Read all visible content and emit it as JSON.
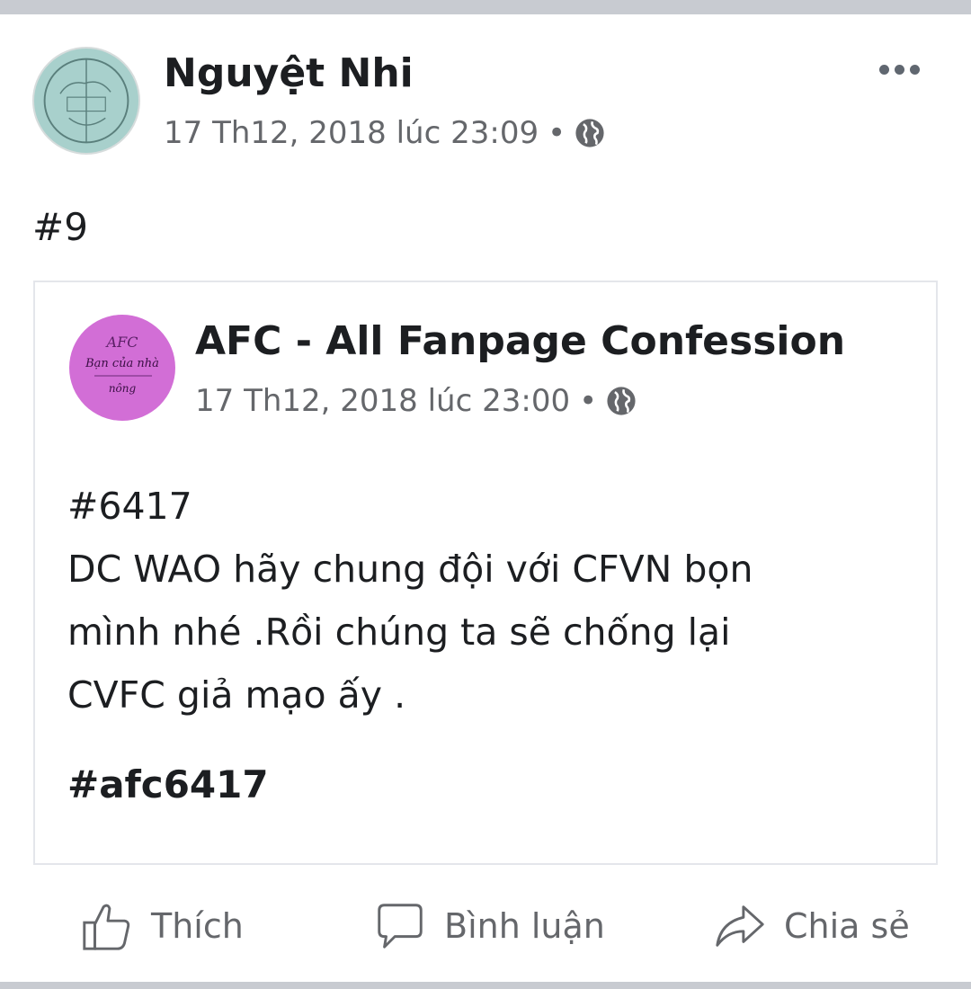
{
  "post": {
    "author": "Nguyệt Nhi",
    "timestamp": "17 Th12, 2018 lúc 23:09",
    "privacy_icon": "globe-icon",
    "text": "#9"
  },
  "shared": {
    "page_name": "AFC - All Fanpage Confession",
    "timestamp": "17 Th12, 2018 lúc 23:00",
    "privacy_icon": "globe-icon",
    "avatar_text": [
      "AFC",
      "Bạn của nhà",
      "nông"
    ],
    "lines": [
      "#6417",
      "DC WAO hãy chung đội với CFVN bọn",
      "mình nhé .Rồi chúng ta sẽ chống lại",
      "CVFC giả mạo ấy ."
    ],
    "hashtag": "#afc6417"
  },
  "actions": {
    "like": "Thích",
    "comment": "Bình luận",
    "share": "Chia sẻ"
  },
  "colors": {
    "text": "#1c1e21",
    "secondary": "#65676b",
    "avatar_teal": "#a8d0cc",
    "avatar_pink": "#d26ed6",
    "border": "#e4e6eb"
  }
}
